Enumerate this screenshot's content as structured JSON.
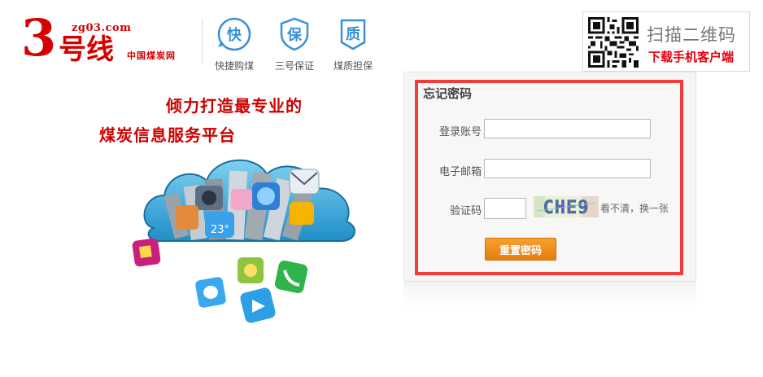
{
  "header": {
    "logo": {
      "big_digit": "3",
      "domain": "zg03.com",
      "name": "号线",
      "subtitle": "中国煤炭网"
    },
    "guarantees": [
      {
        "glyph": "快",
        "label": "快捷购煤",
        "icon": "lightning-circle-icon"
      },
      {
        "glyph": "保",
        "label": "三号保证",
        "icon": "shield-icon"
      },
      {
        "glyph": "质",
        "label": "煤质担保",
        "icon": "badge-icon"
      }
    ],
    "qr": {
      "title": "扫描二维码",
      "subtitle": "下载手机客户端"
    }
  },
  "promo": {
    "slogan_line1": "倾力打造最专业的",
    "slogan_line2": "煤炭信息服务平台",
    "weather_temp": "23°"
  },
  "form": {
    "title": "忘记密码",
    "account_label": "登录账号",
    "account_value": "",
    "email_label": "电子邮箱",
    "email_value": "",
    "captcha_label": "验证码",
    "captcha_value": "",
    "captcha_text": "CHE9",
    "refresh_label": "看不清，换一张",
    "submit_label": "重置密码"
  },
  "colors": {
    "brand_red": "#d60000",
    "panel_border": "#f53a3a",
    "button_orange": "#ef8c1e",
    "icon_blue": "#3a8fd6"
  }
}
